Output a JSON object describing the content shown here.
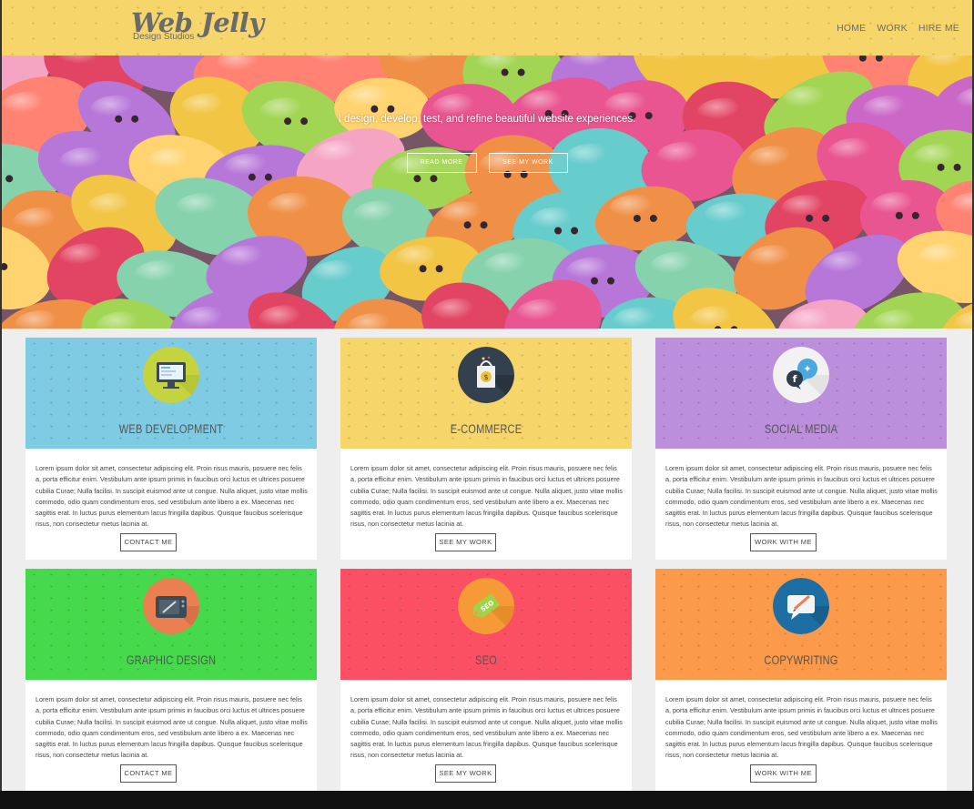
{
  "header": {
    "logo_title": "Web Jelly",
    "logo_subtitle": "Design Studios",
    "nav": [
      {
        "label": "HOME"
      },
      {
        "label": "WORK"
      },
      {
        "label": "HIRE ME"
      }
    ]
  },
  "hero": {
    "tagline": "I design, develop, test, and refine beautiful website experiences.",
    "read_more_label": "READ MORE",
    "see_work_label": "SEE MY WORK"
  },
  "services": [
    {
      "title": "WEB DEVELOPMENT",
      "color": "#7ecbe3",
      "icon": "monitor-icon",
      "button": "CONTACT ME",
      "body": "Lorem ipsum dolor sit amet, consectetur adipiscing elit. Proin risus mauris, posuere nec felis a, porta efficitur enim. Vestibulum ante ipsum primis in faucibus orci luctus et ultrices posuere cubilia Curae; Nulla facilisi. In suscipit euismod ante ut congue. Nulla aliquet, justo vitae mollis commodo, odio quam condimentum eros, sed vestibulum ante libero a ex. Maecenas nec sagittis erat. In luctus purus elementum lacus fringilla dapibus. Quisque faucibus scelerisque risus, non consectetur metus lacinia at."
    },
    {
      "title": "E-COMMERCE",
      "color": "#f6d66a",
      "icon": "shopping-bag-icon",
      "button": "SEE MY WORK",
      "body": "Lorem ipsum dolor sit amet, consectetur adipiscing elit. Proin risus mauris, posuere nec felis a, porta efficitur enim. Vestibulum ante ipsum primis in faucibus orci luctus et ultrices posuere cubilia Curae; Nulla facilisi. In suscipit euismod ante ut congue. Nulla aliquet, justo vitae mollis commodo, odio quam condimentum eros, sed vestibulum ante libero a ex. Maecenas nec sagittis erat. In luctus purus elementum lacus fringilla dapibus. Quisque faucibus scelerisque risus, non consectetur metus lacinia at."
    },
    {
      "title": "SOCIAL MEDIA",
      "color": "#bb8fdc",
      "icon": "social-bubbles-icon",
      "button": "WORK WITH ME",
      "body": "Lorem ipsum dolor sit amet, consectetur adipiscing elit. Proin risus mauris, posuere nec felis a, porta efficitur enim. Vestibulum ante ipsum primis in faucibus orci luctus et ultrices posuere cubilia Curae; Nulla facilisi. In suscipit euismod ante ut congue. Nulla aliquet, justo vitae mollis commodo, odio quam condimentum eros, sed vestibulum ante libero a ex. Maecenas nec sagittis erat. In luctus purus elementum lacus fringilla dapibus. Quisque faucibus scelerisque risus, non consectetur metus lacinia at."
    },
    {
      "title": "GRAPHIC DESIGN",
      "color": "#45d94b",
      "icon": "drawing-tablet-icon",
      "button": "CONTACT ME",
      "body": "Lorem ipsum dolor sit amet, consectetur adipiscing elit. Proin risus mauris, posuere nec felis a, porta efficitur enim. Vestibulum ante ipsum primis in faucibus orci luctus et ultrices posuere cubilia Curae; Nulla facilisi. In suscipit euismod ante ut congue. Nulla aliquet, justo vitae mollis commodo, odio quam condimentum eros, sed vestibulum ante libero a ex. Maecenas nec sagittis erat. In luctus purus elementum lacus fringilla dapibus. Quisque faucibus scelerisque risus, non consectetur metus lacinia at."
    },
    {
      "title": "SEO",
      "color": "#fb5064",
      "icon": "seo-tag-icon",
      "button": "SEE MY WORK",
      "body": "Lorem ipsum dolor sit amet, consectetur adipiscing elit. Proin risus mauris, posuere nec felis a, porta efficitur enim. Vestibulum ante ipsum primis in faucibus orci luctus et ultrices posuere cubilia Curae; Nulla facilisi. In suscipit euismod ante ut congue. Nulla aliquet, justo vitae mollis commodo, odio quam condimentum eros, sed vestibulum ante libero a ex. Maecenas nec sagittis erat. In luctus purus elementum lacus fringilla dapibus. Quisque faucibus scelerisque risus, non consectetur metus lacinia at."
    },
    {
      "title": "COPYWRITING",
      "color": "#fb9a4a",
      "icon": "pen-speech-icon",
      "button": "WORK WITH ME",
      "body": "Lorem ipsum dolor sit amet, consectetur adipiscing elit. Proin risus mauris, posuere nec felis a, porta efficitur enim. Vestibulum ante ipsum primis in faucibus orci luctus et ultrices posuere cubilia Curae; Nulla facilisi. In suscipit euismod ante ut congue. Nulla aliquet, justo vitae mollis commodo, odio quam condimentum eros, sed vestibulum ante libero a ex. Maecenas nec sagittis erat. In luctus purus elementum lacus fringilla dapibus. Quisque faucibus scelerisque risus, non consectetur metus lacinia at."
    }
  ]
}
